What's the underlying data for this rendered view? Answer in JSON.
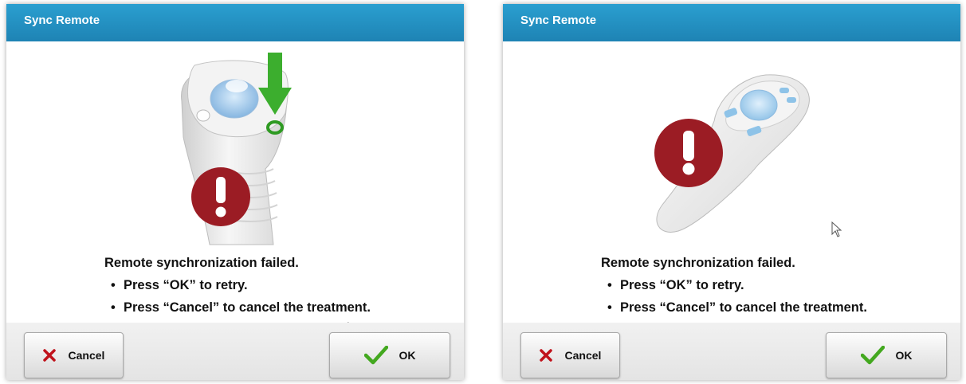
{
  "dialogs": [
    {
      "title": "Sync Remote",
      "message": {
        "heading": "Remote synchronization failed.",
        "bullets": [
          "Press “OK” to retry.",
          "Press “Cancel” to cancel the treatment."
        ]
      },
      "buttons": {
        "cancel": "Cancel",
        "ok": "OK"
      }
    },
    {
      "title": "Sync Remote",
      "message": {
        "heading": "Remote synchronization failed.",
        "bullets": [
          "Press “OK” to retry.",
          "Press “Cancel” to cancel the treatment."
        ]
      },
      "buttons": {
        "cancel": "Cancel",
        "ok": "OK"
      }
    }
  ],
  "colors": {
    "title_bar": "#1e8fc3",
    "error_badge": "#9b1c24",
    "cancel_x": "#c0121b",
    "ok_check": "#43a81f",
    "arrow": "#3cae2e"
  },
  "icons": [
    "error-alert-icon",
    "down-arrow-icon",
    "close-x-icon",
    "checkmark-icon",
    "mouse-cursor-icon"
  ]
}
